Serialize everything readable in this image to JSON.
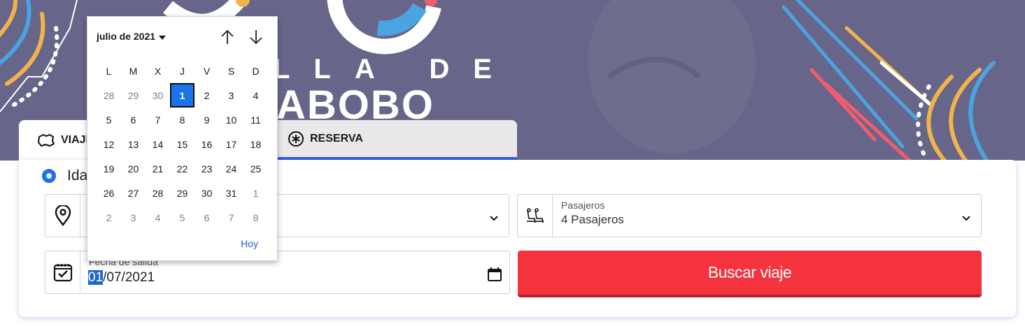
{
  "tabs": {
    "viaje": "VIAJE",
    "reserva": "RESERVA"
  },
  "trip_type": {
    "selected_label": "Ida"
  },
  "passengers": {
    "label": "Pasajeros",
    "value": "4 Pasajeros"
  },
  "departure_date": {
    "label": "Fecha de salida",
    "day": "01",
    "rest": "/07/2021"
  },
  "search_button": "Buscar viaje",
  "banner": {
    "line1": "LLA DE",
    "line2": "ABOBO"
  },
  "calendar": {
    "month_label": "julio de 2021",
    "weekdays": [
      "L",
      "M",
      "X",
      "J",
      "V",
      "S",
      "D"
    ],
    "weeks": [
      [
        {
          "d": "28",
          "m": true
        },
        {
          "d": "29",
          "m": true
        },
        {
          "d": "30",
          "m": true
        },
        {
          "d": "1",
          "t": true
        },
        {
          "d": "2"
        },
        {
          "d": "3"
        },
        {
          "d": "4"
        }
      ],
      [
        {
          "d": "5"
        },
        {
          "d": "6"
        },
        {
          "d": "7"
        },
        {
          "d": "8"
        },
        {
          "d": "9"
        },
        {
          "d": "10"
        },
        {
          "d": "11"
        }
      ],
      [
        {
          "d": "12"
        },
        {
          "d": "13"
        },
        {
          "d": "14"
        },
        {
          "d": "15"
        },
        {
          "d": "16"
        },
        {
          "d": "17"
        },
        {
          "d": "18"
        }
      ],
      [
        {
          "d": "19"
        },
        {
          "d": "20"
        },
        {
          "d": "21"
        },
        {
          "d": "22"
        },
        {
          "d": "23"
        },
        {
          "d": "24"
        },
        {
          "d": "25"
        }
      ],
      [
        {
          "d": "26"
        },
        {
          "d": "27"
        },
        {
          "d": "28"
        },
        {
          "d": "29"
        },
        {
          "d": "30"
        },
        {
          "d": "31"
        },
        {
          "d": "1",
          "m": true
        }
      ],
      [
        {
          "d": "2",
          "m": true
        },
        {
          "d": "3",
          "m": true
        },
        {
          "d": "4",
          "m": true
        },
        {
          "d": "5",
          "m": true
        },
        {
          "d": "6",
          "m": true
        },
        {
          "d": "7",
          "m": true
        },
        {
          "d": "8",
          "m": true
        }
      ]
    ],
    "today_label": "Hoy"
  },
  "colors": {
    "accent": "#1a73e8",
    "button": "#f5333f",
    "banner": "#67668a",
    "tab_underline": "#2f55e8"
  }
}
